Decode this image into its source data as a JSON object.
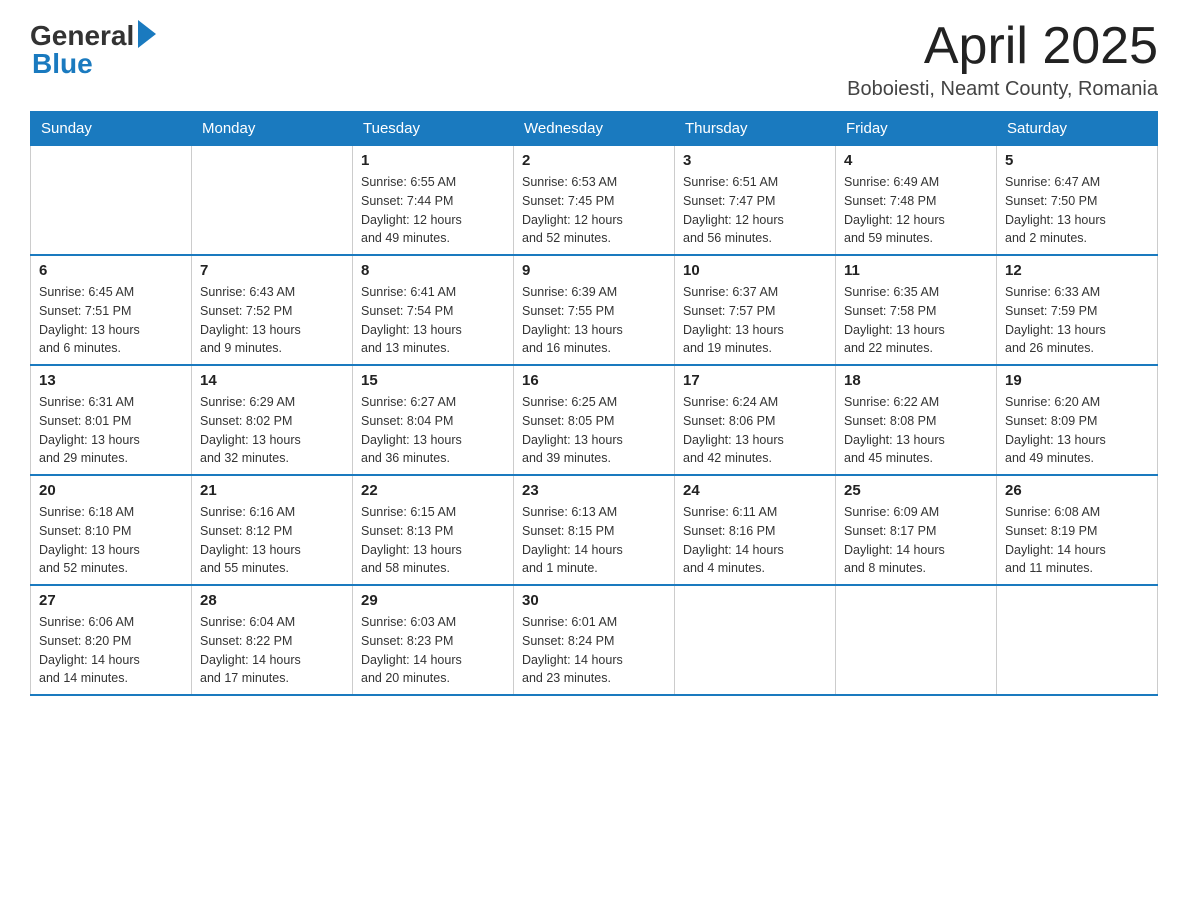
{
  "header": {
    "logo": {
      "general": "General",
      "blue": "Blue"
    },
    "title": "April 2025",
    "location": "Boboiesti, Neamt County, Romania"
  },
  "weekdays": [
    "Sunday",
    "Monday",
    "Tuesday",
    "Wednesday",
    "Thursday",
    "Friday",
    "Saturday"
  ],
  "weeks": [
    [
      {
        "day": "",
        "info": ""
      },
      {
        "day": "",
        "info": ""
      },
      {
        "day": "1",
        "info": "Sunrise: 6:55 AM\nSunset: 7:44 PM\nDaylight: 12 hours\nand 49 minutes."
      },
      {
        "day": "2",
        "info": "Sunrise: 6:53 AM\nSunset: 7:45 PM\nDaylight: 12 hours\nand 52 minutes."
      },
      {
        "day": "3",
        "info": "Sunrise: 6:51 AM\nSunset: 7:47 PM\nDaylight: 12 hours\nand 56 minutes."
      },
      {
        "day": "4",
        "info": "Sunrise: 6:49 AM\nSunset: 7:48 PM\nDaylight: 12 hours\nand 59 minutes."
      },
      {
        "day": "5",
        "info": "Sunrise: 6:47 AM\nSunset: 7:50 PM\nDaylight: 13 hours\nand 2 minutes."
      }
    ],
    [
      {
        "day": "6",
        "info": "Sunrise: 6:45 AM\nSunset: 7:51 PM\nDaylight: 13 hours\nand 6 minutes."
      },
      {
        "day": "7",
        "info": "Sunrise: 6:43 AM\nSunset: 7:52 PM\nDaylight: 13 hours\nand 9 minutes."
      },
      {
        "day": "8",
        "info": "Sunrise: 6:41 AM\nSunset: 7:54 PM\nDaylight: 13 hours\nand 13 minutes."
      },
      {
        "day": "9",
        "info": "Sunrise: 6:39 AM\nSunset: 7:55 PM\nDaylight: 13 hours\nand 16 minutes."
      },
      {
        "day": "10",
        "info": "Sunrise: 6:37 AM\nSunset: 7:57 PM\nDaylight: 13 hours\nand 19 minutes."
      },
      {
        "day": "11",
        "info": "Sunrise: 6:35 AM\nSunset: 7:58 PM\nDaylight: 13 hours\nand 22 minutes."
      },
      {
        "day": "12",
        "info": "Sunrise: 6:33 AM\nSunset: 7:59 PM\nDaylight: 13 hours\nand 26 minutes."
      }
    ],
    [
      {
        "day": "13",
        "info": "Sunrise: 6:31 AM\nSunset: 8:01 PM\nDaylight: 13 hours\nand 29 minutes."
      },
      {
        "day": "14",
        "info": "Sunrise: 6:29 AM\nSunset: 8:02 PM\nDaylight: 13 hours\nand 32 minutes."
      },
      {
        "day": "15",
        "info": "Sunrise: 6:27 AM\nSunset: 8:04 PM\nDaylight: 13 hours\nand 36 minutes."
      },
      {
        "day": "16",
        "info": "Sunrise: 6:25 AM\nSunset: 8:05 PM\nDaylight: 13 hours\nand 39 minutes."
      },
      {
        "day": "17",
        "info": "Sunrise: 6:24 AM\nSunset: 8:06 PM\nDaylight: 13 hours\nand 42 minutes."
      },
      {
        "day": "18",
        "info": "Sunrise: 6:22 AM\nSunset: 8:08 PM\nDaylight: 13 hours\nand 45 minutes."
      },
      {
        "day": "19",
        "info": "Sunrise: 6:20 AM\nSunset: 8:09 PM\nDaylight: 13 hours\nand 49 minutes."
      }
    ],
    [
      {
        "day": "20",
        "info": "Sunrise: 6:18 AM\nSunset: 8:10 PM\nDaylight: 13 hours\nand 52 minutes."
      },
      {
        "day": "21",
        "info": "Sunrise: 6:16 AM\nSunset: 8:12 PM\nDaylight: 13 hours\nand 55 minutes."
      },
      {
        "day": "22",
        "info": "Sunrise: 6:15 AM\nSunset: 8:13 PM\nDaylight: 13 hours\nand 58 minutes."
      },
      {
        "day": "23",
        "info": "Sunrise: 6:13 AM\nSunset: 8:15 PM\nDaylight: 14 hours\nand 1 minute."
      },
      {
        "day": "24",
        "info": "Sunrise: 6:11 AM\nSunset: 8:16 PM\nDaylight: 14 hours\nand 4 minutes."
      },
      {
        "day": "25",
        "info": "Sunrise: 6:09 AM\nSunset: 8:17 PM\nDaylight: 14 hours\nand 8 minutes."
      },
      {
        "day": "26",
        "info": "Sunrise: 6:08 AM\nSunset: 8:19 PM\nDaylight: 14 hours\nand 11 minutes."
      }
    ],
    [
      {
        "day": "27",
        "info": "Sunrise: 6:06 AM\nSunset: 8:20 PM\nDaylight: 14 hours\nand 14 minutes."
      },
      {
        "day": "28",
        "info": "Sunrise: 6:04 AM\nSunset: 8:22 PM\nDaylight: 14 hours\nand 17 minutes."
      },
      {
        "day": "29",
        "info": "Sunrise: 6:03 AM\nSunset: 8:23 PM\nDaylight: 14 hours\nand 20 minutes."
      },
      {
        "day": "30",
        "info": "Sunrise: 6:01 AM\nSunset: 8:24 PM\nDaylight: 14 hours\nand 23 minutes."
      },
      {
        "day": "",
        "info": ""
      },
      {
        "day": "",
        "info": ""
      },
      {
        "day": "",
        "info": ""
      }
    ]
  ]
}
